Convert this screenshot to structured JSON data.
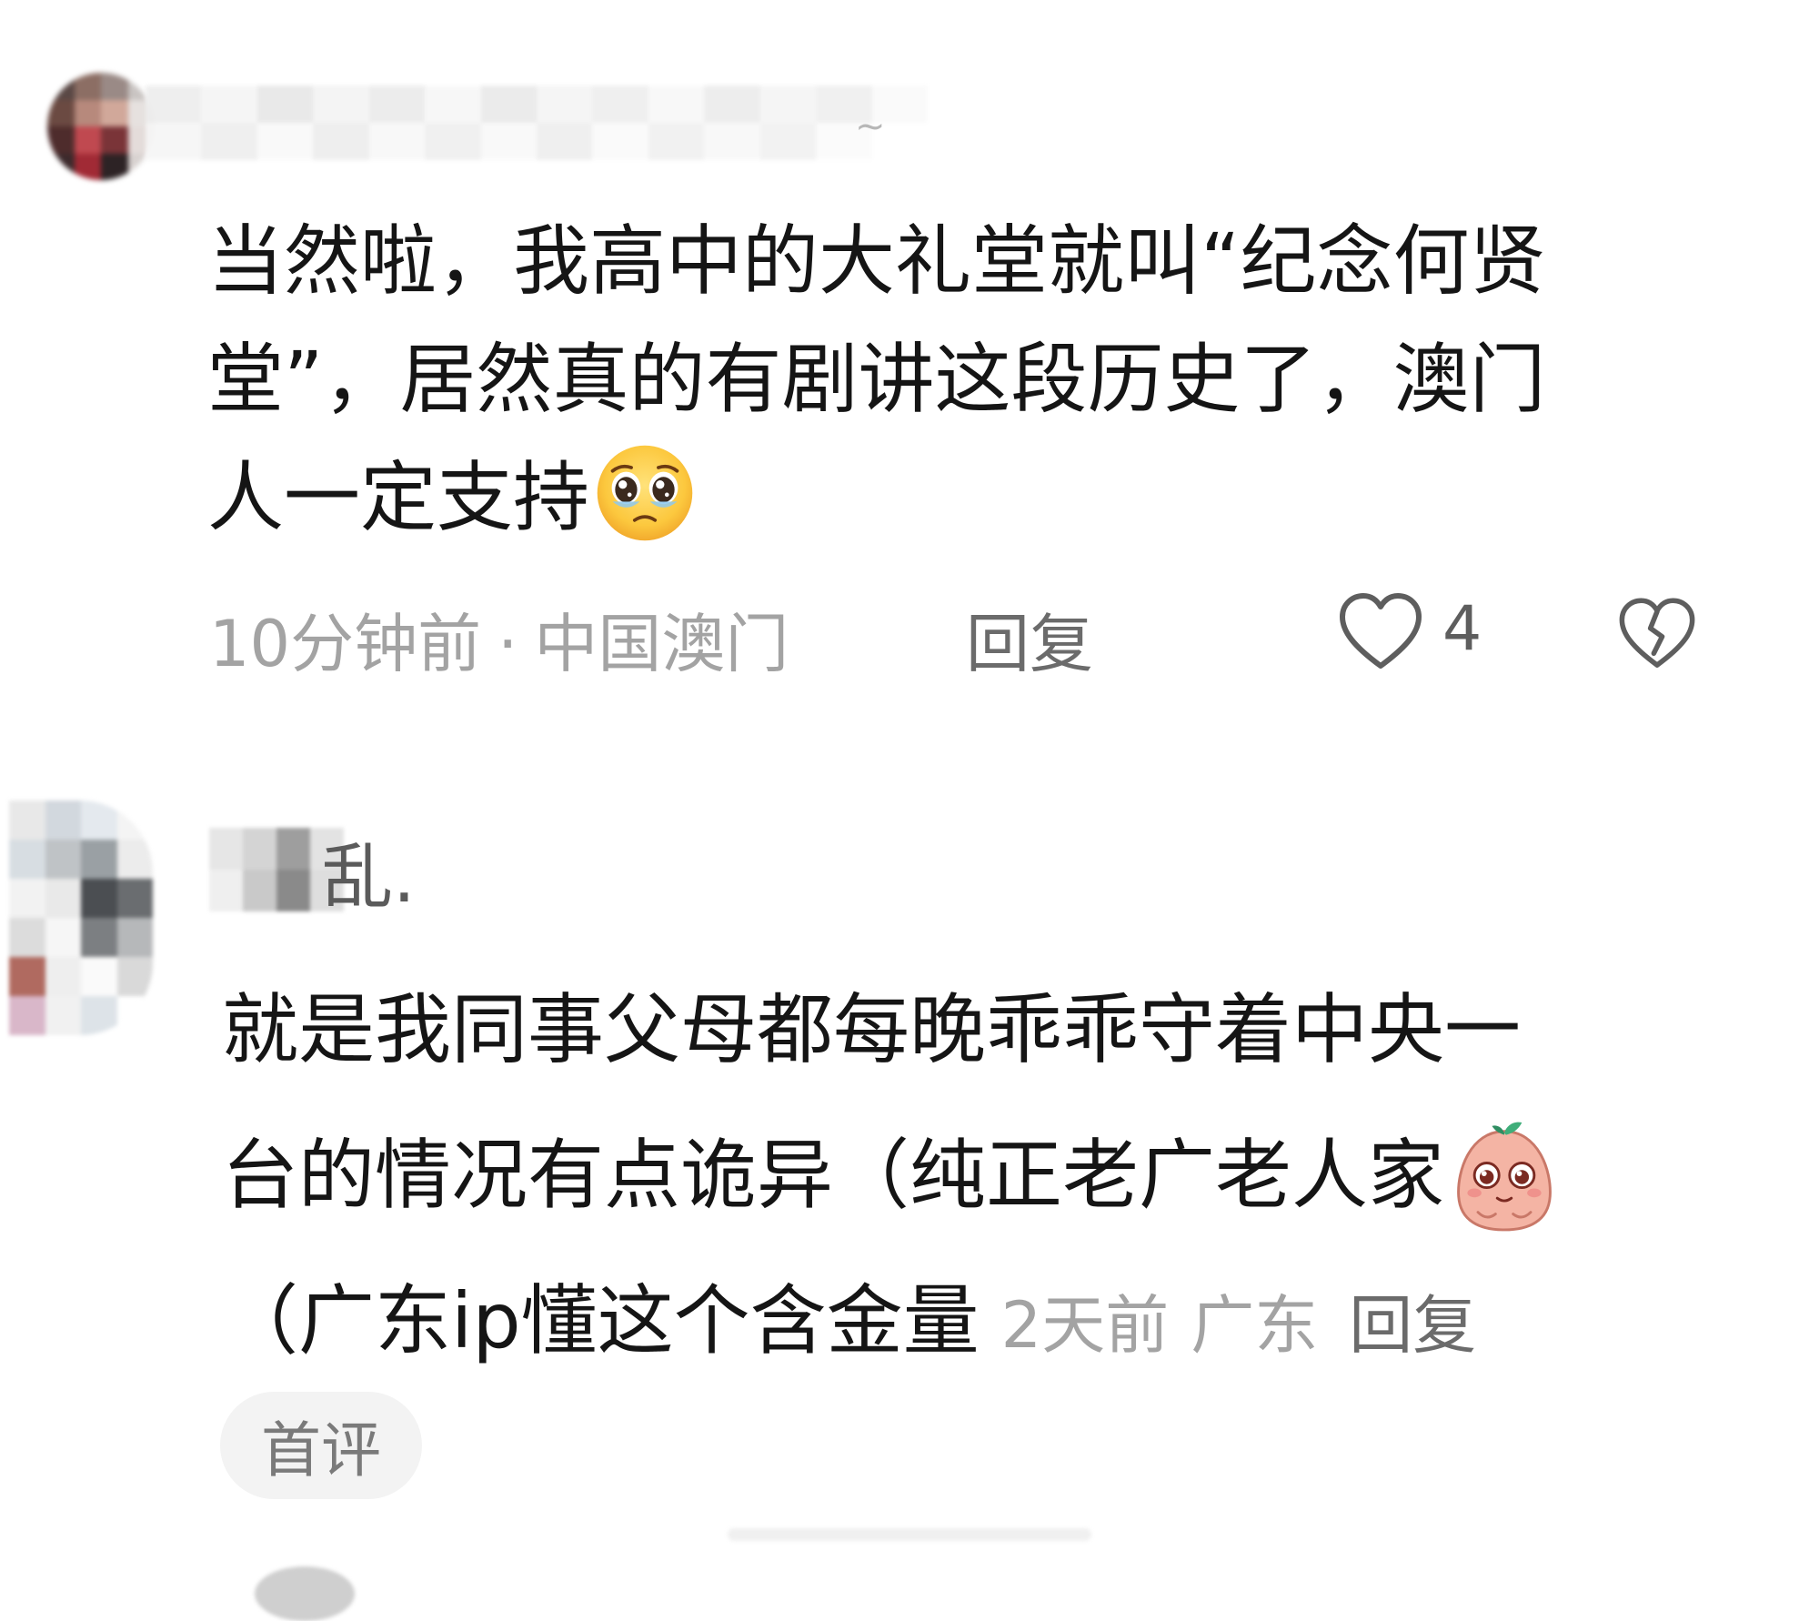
{
  "comments": [
    {
      "username_visible": "~",
      "text_lines": [
        "当然啦，我高中的大礼堂就叫“纪念何贤",
        "堂”，居然真的有剧讲这段历史了，澳门",
        "人一定支持"
      ],
      "emoji": "pleading-face-icon",
      "time": "10分钟前",
      "separator": "·",
      "location": "中国澳门",
      "reply_label": "回复",
      "like_count": "4"
    },
    {
      "username_visible": "乱.",
      "text_lines": [
        "就是我同事父母都每晚乖乖守着中央一",
        "台的情况有点诡异（纯正老广老人家",
        "（广东ip懂这个含金量"
      ],
      "emoji": "peach-face-icon",
      "time": "2天前",
      "location": "广东",
      "reply_label": "回复",
      "badge": "首评"
    }
  ],
  "colors": {
    "text": "#151515",
    "meta": "#a3a3a3",
    "reply": "#6b6b6b",
    "badge_bg": "#f3f3f3"
  }
}
